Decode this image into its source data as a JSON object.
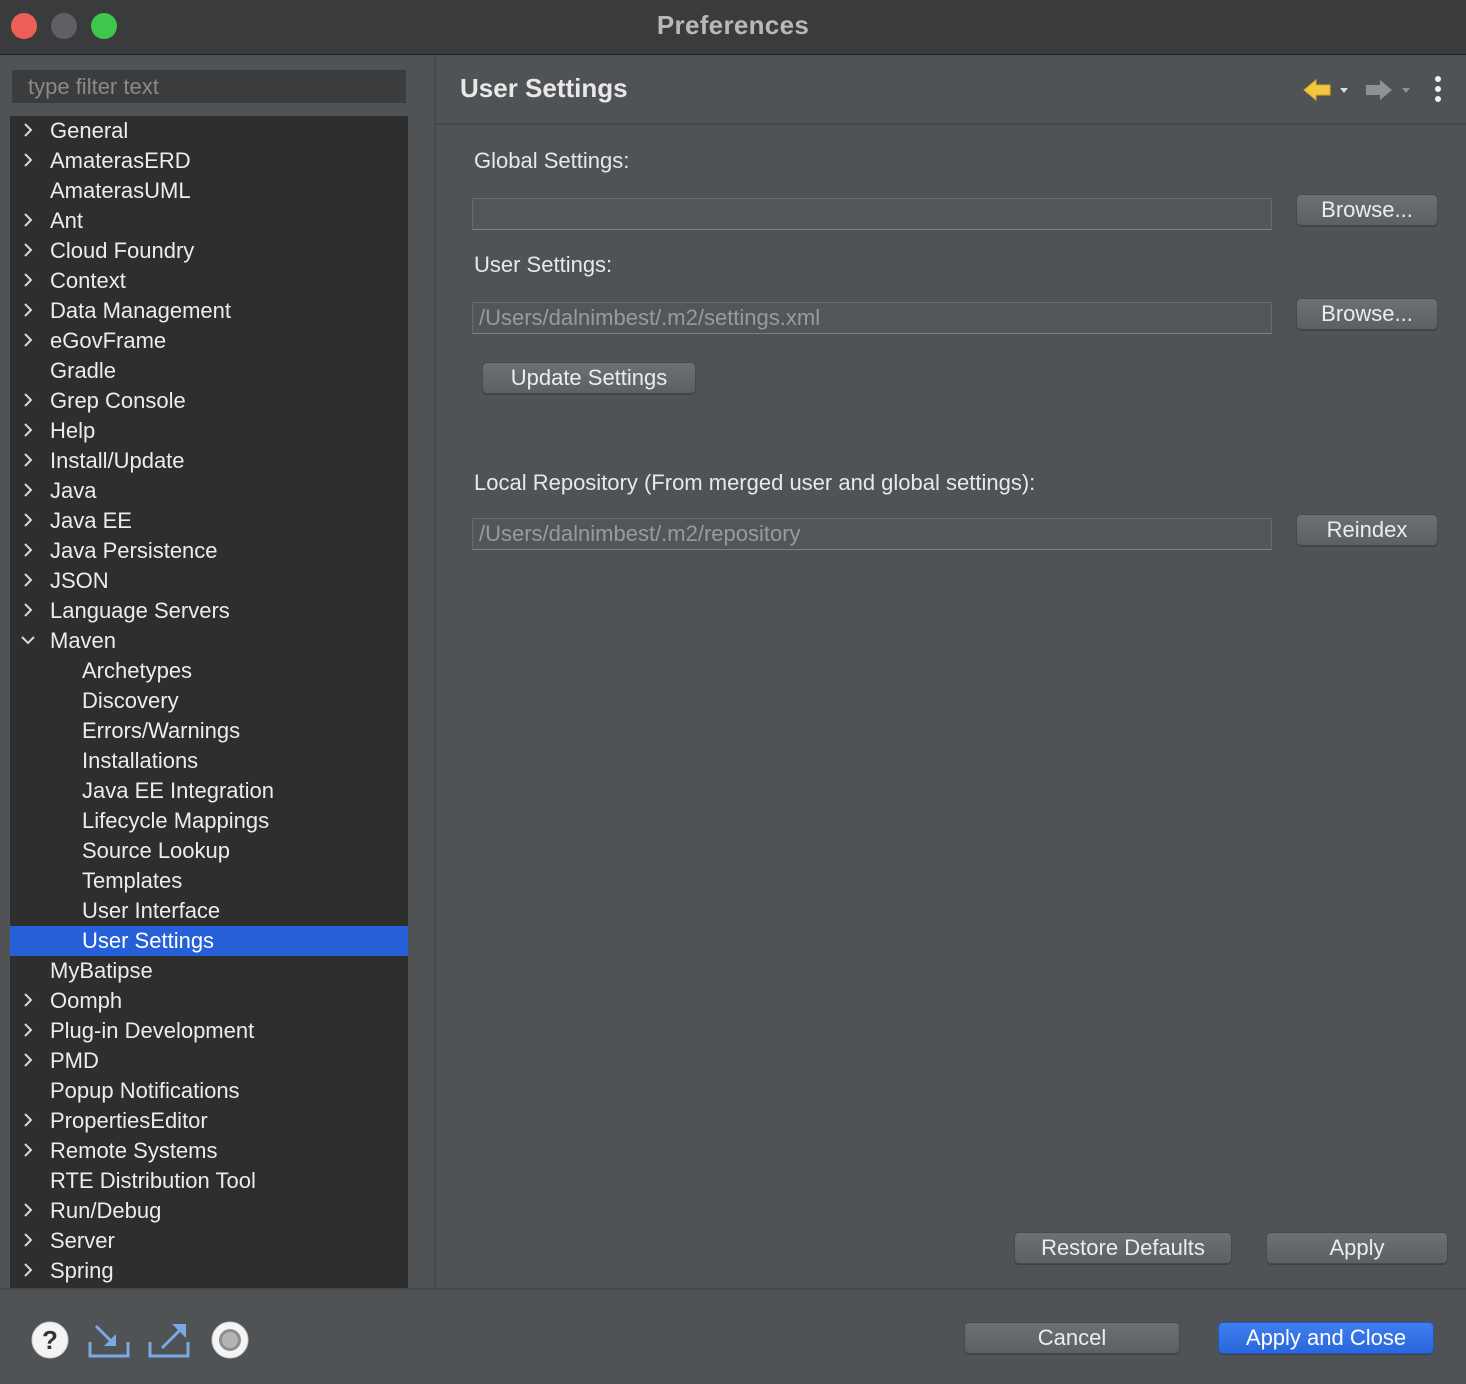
{
  "window": {
    "title": "Preferences"
  },
  "filter": {
    "placeholder": "type filter text"
  },
  "tree": [
    {
      "label": "General",
      "expandable": true,
      "level": 0
    },
    {
      "label": "AmaterasERD",
      "expandable": true,
      "level": 0
    },
    {
      "label": "AmaterasUML",
      "expandable": false,
      "level": 0
    },
    {
      "label": "Ant",
      "expandable": true,
      "level": 0
    },
    {
      "label": "Cloud Foundry",
      "expandable": true,
      "level": 0
    },
    {
      "label": "Context",
      "expandable": true,
      "level": 0
    },
    {
      "label": "Data Management",
      "expandable": true,
      "level": 0
    },
    {
      "label": "eGovFrame",
      "expandable": true,
      "level": 0
    },
    {
      "label": "Gradle",
      "expandable": false,
      "level": 0
    },
    {
      "label": "Grep Console",
      "expandable": true,
      "level": 0
    },
    {
      "label": "Help",
      "expandable": true,
      "level": 0
    },
    {
      "label": "Install/Update",
      "expandable": true,
      "level": 0
    },
    {
      "label": "Java",
      "expandable": true,
      "level": 0
    },
    {
      "label": "Java EE",
      "expandable": true,
      "level": 0
    },
    {
      "label": "Java Persistence",
      "expandable": true,
      "level": 0
    },
    {
      "label": "JSON",
      "expandable": true,
      "level": 0
    },
    {
      "label": "Language Servers",
      "expandable": true,
      "level": 0
    },
    {
      "label": "Maven",
      "expandable": true,
      "expanded": true,
      "level": 0
    },
    {
      "label": "Archetypes",
      "expandable": false,
      "level": 1
    },
    {
      "label": "Discovery",
      "expandable": false,
      "level": 1
    },
    {
      "label": "Errors/Warnings",
      "expandable": false,
      "level": 1
    },
    {
      "label": "Installations",
      "expandable": false,
      "level": 1
    },
    {
      "label": "Java EE Integration",
      "expandable": false,
      "level": 1
    },
    {
      "label": "Lifecycle Mappings",
      "expandable": false,
      "level": 1
    },
    {
      "label": "Source Lookup",
      "expandable": false,
      "level": 1
    },
    {
      "label": "Templates",
      "expandable": false,
      "level": 1
    },
    {
      "label": "User Interface",
      "expandable": false,
      "level": 1
    },
    {
      "label": "User Settings",
      "expandable": false,
      "level": 1,
      "selected": true
    },
    {
      "label": "MyBatipse",
      "expandable": false,
      "level": 0
    },
    {
      "label": "Oomph",
      "expandable": true,
      "level": 0
    },
    {
      "label": "Plug-in Development",
      "expandable": true,
      "level": 0
    },
    {
      "label": "PMD",
      "expandable": true,
      "level": 0
    },
    {
      "label": "Popup Notifications",
      "expandable": false,
      "level": 0
    },
    {
      "label": "PropertiesEditor",
      "expandable": true,
      "level": 0
    },
    {
      "label": "Remote Systems",
      "expandable": true,
      "level": 0
    },
    {
      "label": "RTE Distribution Tool",
      "expandable": false,
      "level": 0
    },
    {
      "label": "Run/Debug",
      "expandable": true,
      "level": 0
    },
    {
      "label": "Server",
      "expandable": true,
      "level": 0
    },
    {
      "label": "Spring",
      "expandable": true,
      "level": 0
    }
  ],
  "page": {
    "title": "User Settings",
    "global_label": "Global Settings:",
    "global_value": "",
    "user_label": "User Settings:",
    "user_value": "/Users/dalnimbest/.m2/settings.xml",
    "browse_label": "Browse...",
    "update_label": "Update Settings",
    "local_repo_label": "Local Repository (From merged user and global settings):",
    "local_repo_value": "/Users/dalnimbest/.m2/repository",
    "reindex_label": "Reindex",
    "restore_label": "Restore Defaults",
    "apply_label": "Apply"
  },
  "footer": {
    "cancel_label": "Cancel",
    "apply_close_label": "Apply and Close",
    "icons": [
      "help-icon",
      "import-icon",
      "export-icon",
      "settings-record-icon"
    ]
  },
  "colors": {
    "selection": "#2560d8",
    "primary_button": "#2a66db",
    "back_arrow": "#f3c644"
  }
}
